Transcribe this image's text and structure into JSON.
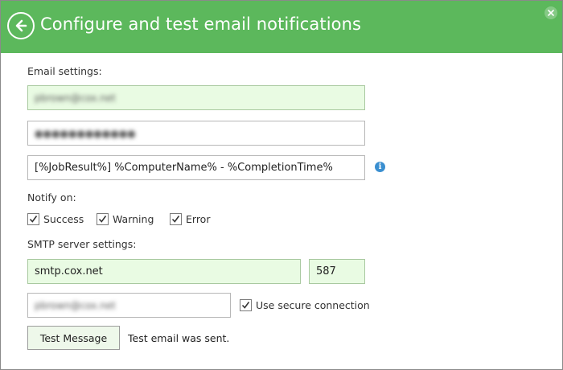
{
  "header": {
    "title": "Configure and test email notifications",
    "background_color": "#5cb85c"
  },
  "email_settings": {
    "label": "Email settings:",
    "email_value": "pbrown@cox.net",
    "password_value": "●●●●●●●●●●●●",
    "subject_value": "[%JobResult%] %ComputerName% - %CompletionTime%"
  },
  "notify_on": {
    "label": "Notify on:",
    "options": [
      {
        "label": "Success",
        "checked": true
      },
      {
        "label": "Warning",
        "checked": true
      },
      {
        "label": "Error",
        "checked": true
      }
    ]
  },
  "smtp_settings": {
    "label": "SMTP server settings:",
    "server_value": "smtp.cox.net",
    "port_value": "587",
    "username_value": "pbrown@cox.net",
    "secure_connection": {
      "label": "Use secure connection",
      "checked": true
    }
  },
  "test": {
    "button_label": "Test Message",
    "status_text": "Test email was sent."
  },
  "icons": {
    "back": "arrow-left-circle-icon",
    "close": "close-icon",
    "info": "info-icon",
    "check": "checkmark-icon"
  }
}
